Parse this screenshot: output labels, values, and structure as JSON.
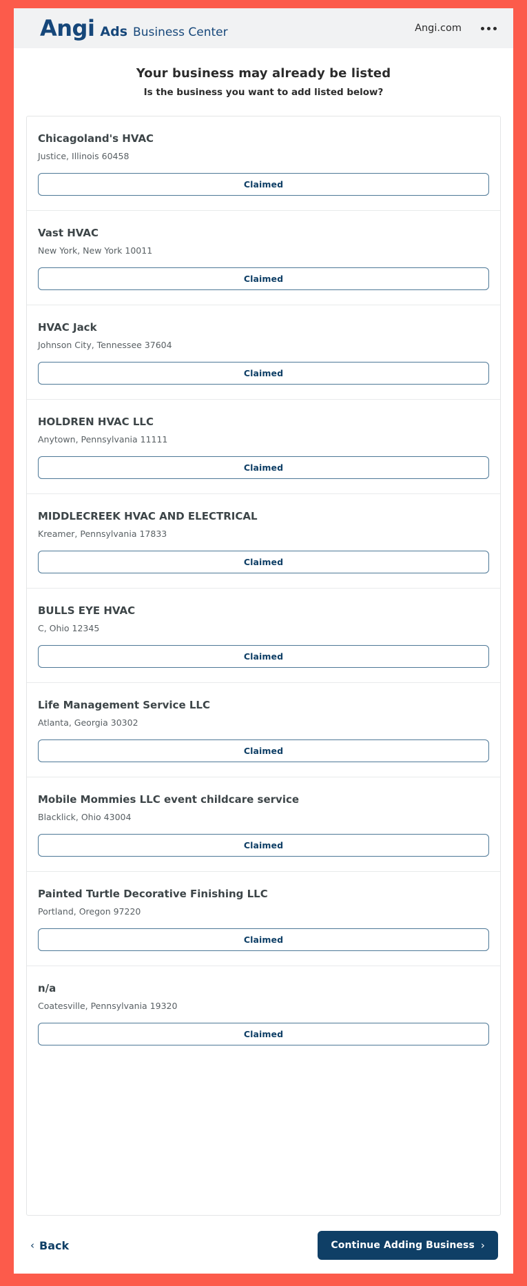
{
  "theme": {
    "frame_color": "#fc5b4b",
    "brand_navy": "#16477a",
    "button_navy": "#0f3f66",
    "button_border": "#4c7796",
    "header_bg": "#f1f2f3"
  },
  "header": {
    "logo_text": "Angi",
    "logo_ads": "Ads",
    "logo_suffix": "Business Center",
    "right_link": "Angi.com",
    "menu_icon": "kebab-menu-icon"
  },
  "main": {
    "title": "Your business may already be listed",
    "subtitle": "Is the business you want to add listed below?",
    "businesses": [
      {
        "name": "Chicagoland's HVAC",
        "address": "Justice, Illinois 60458",
        "action": "Claimed"
      },
      {
        "name": "Vast HVAC",
        "address": "New York, New York 10011",
        "action": "Claimed"
      },
      {
        "name": "HVAC Jack",
        "address": "Johnson City, Tennessee 37604",
        "action": "Claimed"
      },
      {
        "name": "HOLDREN HVAC LLC",
        "address": "Anytown, Pennsylvania 11111",
        "action": "Claimed"
      },
      {
        "name": "MIDDLECREEK HVAC AND ELECTRICAL",
        "address": "Kreamer, Pennsylvania 17833",
        "action": "Claimed"
      },
      {
        "name": "BULLS EYE HVAC",
        "address": "C, Ohio 12345",
        "action": "Claimed"
      },
      {
        "name": "Life Management Service LLC",
        "address": "Atlanta, Georgia 30302",
        "action": "Claimed"
      },
      {
        "name": "Mobile Mommies LLC event childcare service",
        "address": "Blacklick, Ohio 43004",
        "action": "Claimed"
      },
      {
        "name": "Painted Turtle Decorative Finishing LLC",
        "address": "Portland, Oregon 97220",
        "action": "Claimed"
      },
      {
        "name": "n/a",
        "address": "Coatesville, Pennsylvania 19320",
        "action": "Claimed"
      }
    ]
  },
  "footer": {
    "back_label": "Back",
    "back_chevron": "‹",
    "continue_label": "Continue Adding Business",
    "continue_chevron": "›"
  }
}
